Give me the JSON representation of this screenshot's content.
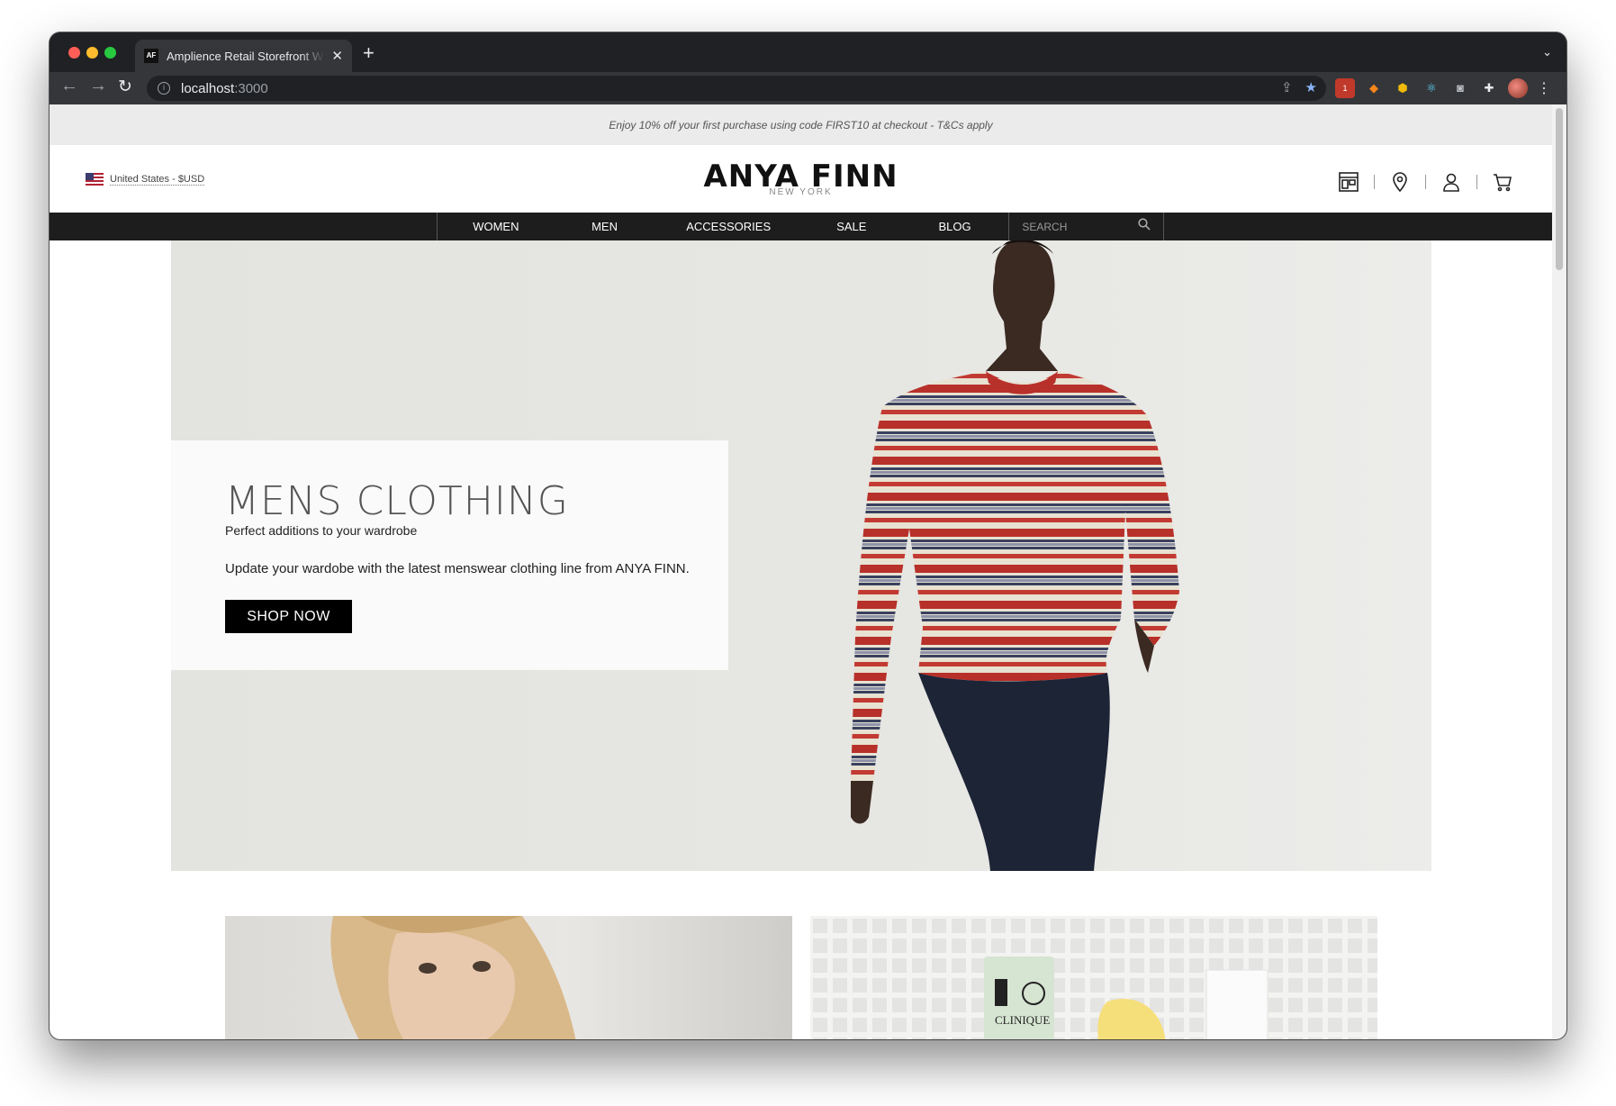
{
  "browser": {
    "tab_title": "Amplience Retail Storefront Web",
    "tab_favicon": "AF",
    "url_host": "localhost",
    "url_port": ":3000",
    "extension_badge": "1"
  },
  "promo_banner": {
    "text": "Enjoy 10% off your first purchase using code FIRST10 at checkout - T&Cs apply"
  },
  "header": {
    "locale": "United States - $USD",
    "logo_main": "ANYA FINN",
    "logo_sub": "NEW YORK",
    "icons": [
      "store-locator-icon",
      "location-pin-icon",
      "account-icon",
      "cart-icon"
    ]
  },
  "nav": {
    "items": [
      "WOMEN",
      "MEN",
      "ACCESSORIES",
      "SALE",
      "BLOG"
    ],
    "search_placeholder": "SEARCH"
  },
  "hero": {
    "title": "MENS CLOTHING",
    "subtitle": "Perfect additions to your wardrobe",
    "description": "Update your wardobe with the latest menswear clothing line from ANYA FINN.",
    "cta": "SHOP NOW"
  },
  "tiles": {
    "right_product_label": "CLINIQUE"
  },
  "colors": {
    "nav_bg": "#1d1d1d",
    "promo_bg": "#ebebeb",
    "hero_bg": "#e4e4e0",
    "cta_bg": "#000000"
  }
}
